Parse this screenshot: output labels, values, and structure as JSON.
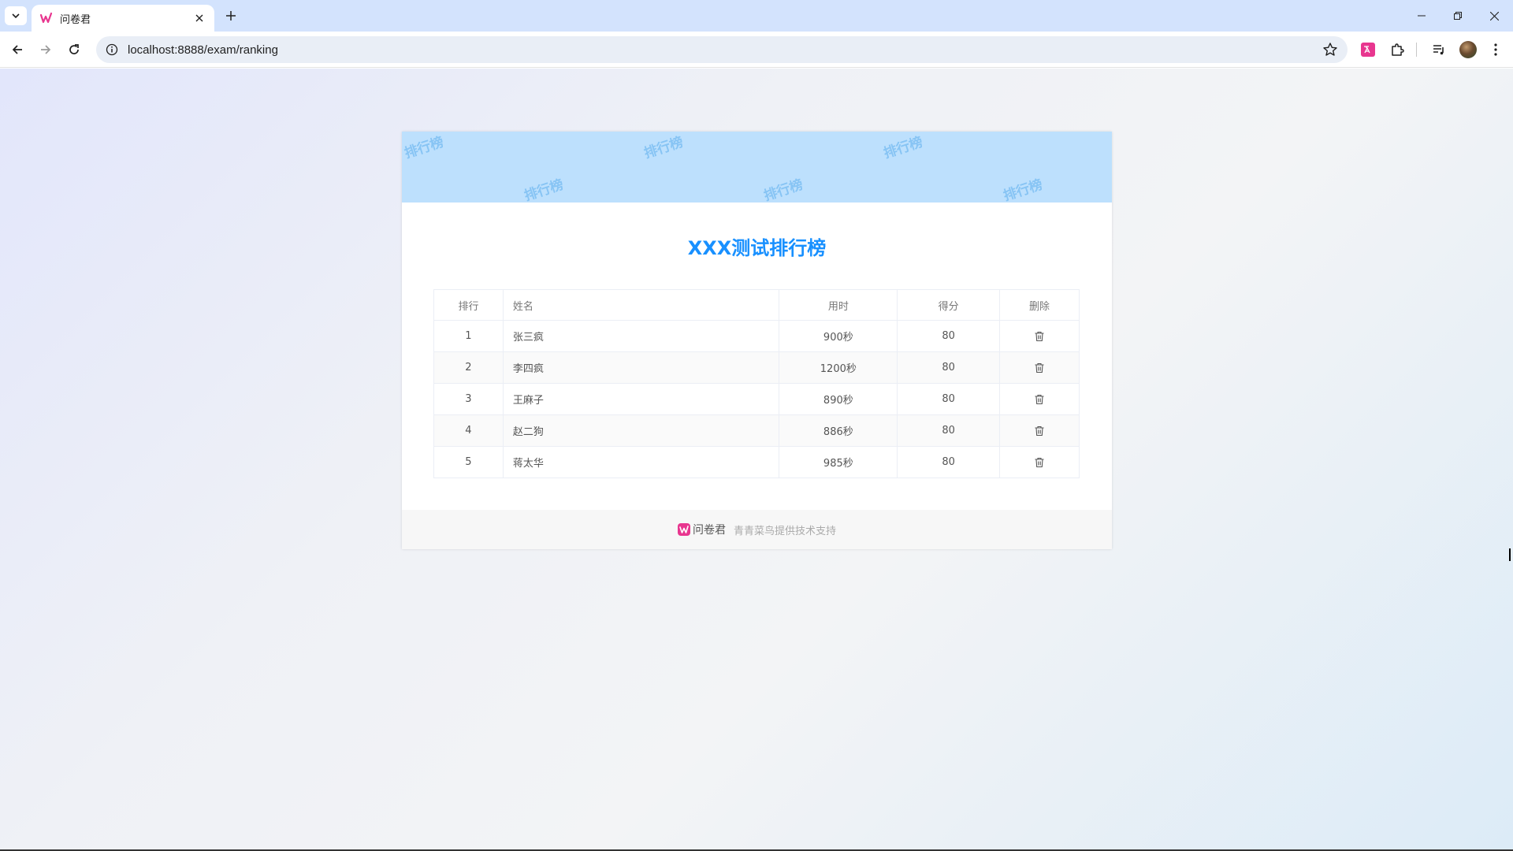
{
  "browser": {
    "tab_title": "问卷君",
    "url": "localhost:8888/exam/ranking"
  },
  "colors": {
    "accent": "#1890ff",
    "banner": "#bde0fd",
    "brand_pink": "#e8368f"
  },
  "icons": [
    "tab-list-icon",
    "close-icon",
    "plus-icon",
    "minimize-icon",
    "restore-icon",
    "back-icon",
    "forward-icon",
    "reload-icon",
    "info-icon",
    "star-icon",
    "translate-extension-icon",
    "puzzle-icon",
    "media-icon",
    "more-icon",
    "trash-icon"
  ],
  "page": {
    "watermark": "排行榜",
    "title": "XXX测试排行榜",
    "table": {
      "headers": {
        "rank": "排行",
        "name": "姓名",
        "time": "用时",
        "score": "得分",
        "delete": "删除"
      },
      "rows": [
        {
          "rank": "1",
          "name": "张三疯",
          "time": "900秒",
          "score": "80"
        },
        {
          "rank": "2",
          "name": "李四疯",
          "time": "1200秒",
          "score": "80"
        },
        {
          "rank": "3",
          "name": "王麻子",
          "time": "890秒",
          "score": "80"
        },
        {
          "rank": "4",
          "name": "赵二狗",
          "time": "886秒",
          "score": "80"
        },
        {
          "rank": "5",
          "name": "蒋太华",
          "time": "985秒",
          "score": "80"
        }
      ]
    },
    "footer": {
      "brand": "问卷君",
      "support": "青青菜鸟提供技术支持"
    }
  }
}
